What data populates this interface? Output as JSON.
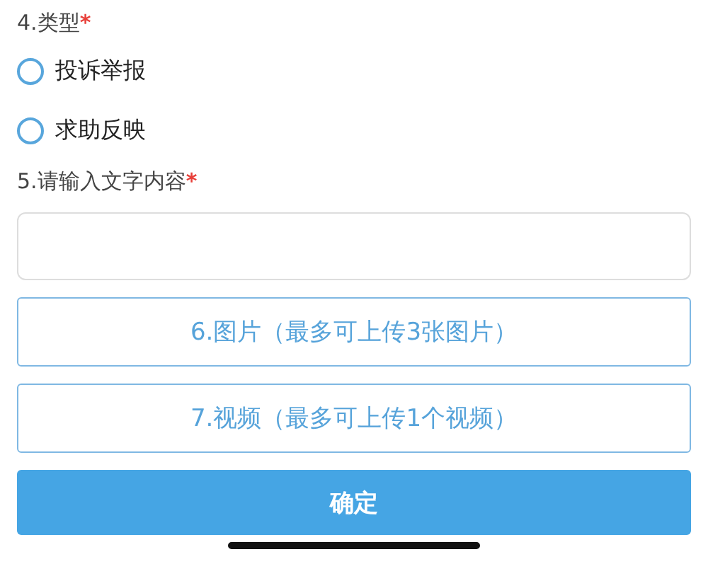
{
  "type_question": {
    "label": "4.类型",
    "required_mark": "*",
    "options": [
      {
        "label": "投诉举报",
        "selected": false
      },
      {
        "label": "求助反映",
        "selected": false
      }
    ]
  },
  "text_question": {
    "label": "5.请输入文字内容",
    "required_mark": "*"
  },
  "uploads": [
    {
      "label": "6.图片（最多可上传3张图片）"
    },
    {
      "label": "7.视频（最多可上传1个视频）"
    }
  ],
  "submit": "确定"
}
